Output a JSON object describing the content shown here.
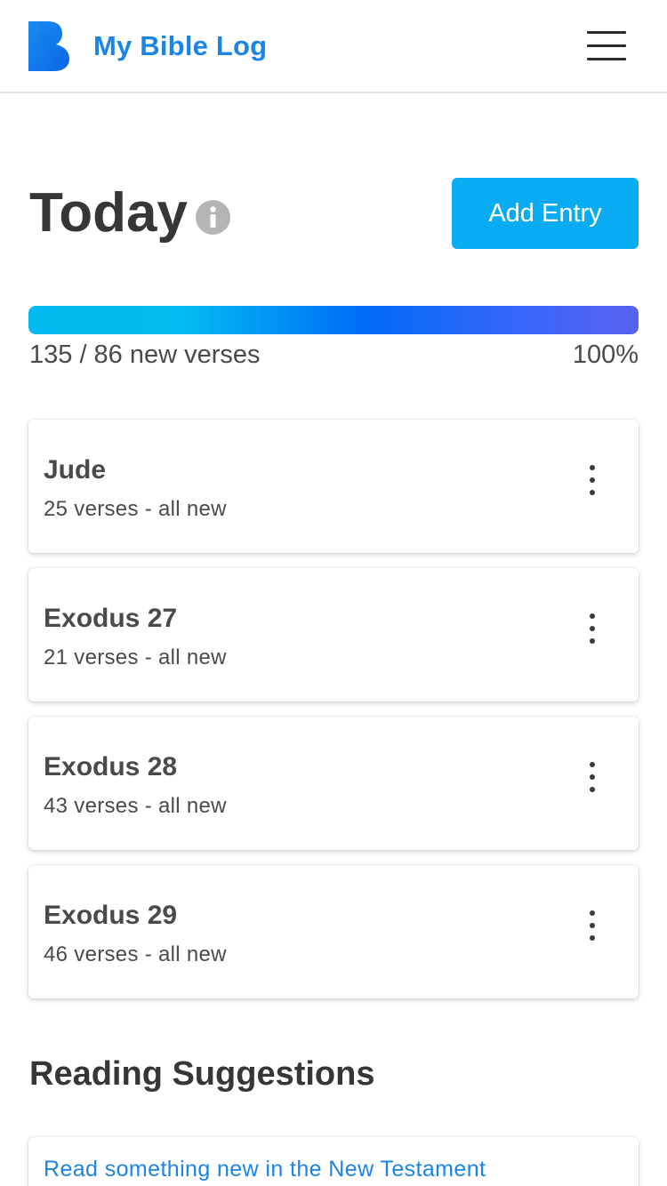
{
  "navbar": {
    "app_name": "My Bible Log",
    "logo_icon": "bible-log-logo",
    "menu_icon": "hamburger-menu-icon",
    "brand_color": "#1a85e6"
  },
  "today": {
    "title": "Today",
    "info_icon": "info-icon",
    "add_entry_label": "Add Entry",
    "button_color": "#09acf2"
  },
  "progress": {
    "label": "135 / 86 new verses",
    "percent_label": "100%",
    "fraction": 1.0
  },
  "entries": [
    {
      "title": "Jude",
      "subtitle": "25 verses - all new"
    },
    {
      "title": "Exodus 27",
      "subtitle": "21 verses - all new"
    },
    {
      "title": "Exodus 28",
      "subtitle": "43 verses - all new"
    },
    {
      "title": "Exodus 29",
      "subtitle": "46 verses - all new"
    }
  ],
  "suggestions": {
    "title": "Reading Suggestions",
    "items": [
      {
        "label": "Read something new in the New Testament"
      }
    ]
  }
}
